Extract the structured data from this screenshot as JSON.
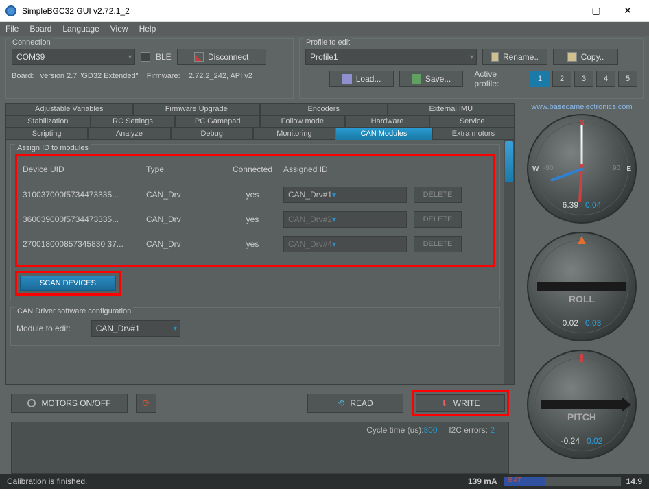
{
  "window": {
    "title": "SimpleBGC32 GUI v2.72.1_2"
  },
  "menu": [
    "File",
    "Board",
    "Language",
    "View",
    "Help"
  ],
  "connection": {
    "title": "Connection",
    "port": "COM39",
    "ble_label": "BLE",
    "disconnect_label": "Disconnect",
    "info_board": "Board:",
    "info_version": "version 2.7 \"GD32 Extended\"",
    "info_fw_label": "Firmware:",
    "info_fw": "2.72.2_242, API v2"
  },
  "profile": {
    "title": "Profile to edit",
    "selected": "Profile1",
    "rename_label": "Rename..",
    "copy_label": "Copy..",
    "load_label": "Load...",
    "save_label": "Save...",
    "active_label": "Active profile:",
    "buttons": [
      "1",
      "2",
      "3",
      "4",
      "5"
    ],
    "active_index": 0
  },
  "tabs": {
    "row1": [
      "Adjustable Variables",
      "Firmware Upgrade",
      "Encoders",
      "External IMU"
    ],
    "row2": [
      "Stabilization",
      "RC Settings",
      "PC Gamepad",
      "Follow mode",
      "Hardware",
      "Service"
    ],
    "row3": [
      "Scripting",
      "Analyze",
      "Debug",
      "Monitoring",
      "CAN Modules",
      "Extra motors"
    ],
    "active": "CAN Modules"
  },
  "assign": {
    "title": "Assign ID to modules",
    "headers": {
      "uid": "Device UID",
      "type": "Type",
      "connected": "Connected",
      "assigned": "Assigned ID"
    },
    "rows": [
      {
        "uid": "310037000f5734473335...",
        "type": "CAN_Drv",
        "connected": "yes",
        "assigned": "CAN_Drv#1",
        "enabled": true
      },
      {
        "uid": "360039000f5734473335...",
        "type": "CAN_Drv",
        "connected": "yes",
        "assigned": "CAN_Drv#2",
        "enabled": false
      },
      {
        "uid": "270018000857345830 37...",
        "type": "CAN_Drv",
        "connected": "yes",
        "assigned": "CAN_Drv#4",
        "enabled": false
      }
    ],
    "delete_label": "DELETE",
    "scan_label": "SCAN DEVICES"
  },
  "config": {
    "title": "CAN Driver software configuration",
    "module_label": "Module to edit:",
    "module_value": "CAN_Drv#1"
  },
  "bottom": {
    "motors_label": "MOTORS ON/OFF",
    "read_label": "READ",
    "write_label": "WRITE"
  },
  "status": {
    "cycle_label": "Cycle time (us):",
    "cycle_value": "800",
    "i2c_label": "I2C errors:",
    "i2c_value": "2"
  },
  "gauges": {
    "link": "www.basecamelectronics.com",
    "compass": {
      "v1": "6.39",
      "v2": "0.04",
      "tick_l": "-90",
      "tick_r": "90"
    },
    "roll": {
      "label": "ROLL",
      "v1": "0.02",
      "v2": "0.03",
      "tick_l": "-90",
      "tick_r": "90"
    },
    "pitch": {
      "label": "PITCH",
      "v1": "-0.24",
      "v2": "0.02",
      "tick_l": "-90",
      "tick_r": "90"
    }
  },
  "footer": {
    "status": "Calibration is finished.",
    "current": "139 mA",
    "bat_label": "BAT",
    "bat_value": "14.9"
  }
}
